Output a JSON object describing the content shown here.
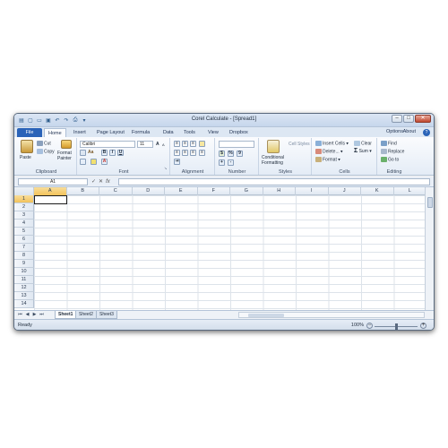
{
  "window": {
    "title": "Corel Calculate - [Spread1]"
  },
  "tabs": {
    "file": "File",
    "items": [
      "Home",
      "Insert",
      "Page Layout",
      "Formula",
      "Data",
      "Tools",
      "View",
      "Dropbox"
    ],
    "options": "Options",
    "about": "About",
    "help": "?"
  },
  "ribbon": {
    "clipboard": {
      "paste": "Paste",
      "cut": "Cut",
      "copy": "Copy",
      "format_painter_1": "Format",
      "format_painter_2": "Painter",
      "label": "Clipboard"
    },
    "font": {
      "family": "Calibri",
      "size": "11",
      "label": "Font",
      "bold": "B",
      "italic": "I",
      "underline": "U",
      "grow": "A",
      "shrink": "A"
    },
    "alignment": {
      "label": "Alignment"
    },
    "number": {
      "label": "Number",
      "pct": "%",
      "comma": "9"
    },
    "styles": {
      "cond_1": "Conditional",
      "cond_2": "Formatting",
      "cell_styles": "Cell Styles",
      "label": "Styles"
    },
    "cells": {
      "insert": "Insert Cells",
      "delete": "Delete...",
      "format": "Format",
      "label": "Cells"
    },
    "editing": {
      "clear": "Clear",
      "sum": "Sum",
      "find": "Find",
      "replace": "Replace",
      "goto": "Go to",
      "label": "Editing"
    }
  },
  "formula_bar": {
    "name_box": "A1",
    "icons": [
      "check-icon",
      "cancel-icon",
      "fx-icon"
    ],
    "fx": "fx",
    "cancel": "✕",
    "accept": "✓"
  },
  "grid": {
    "columns": [
      "A",
      "B",
      "C",
      "D",
      "E",
      "F",
      "G",
      "H",
      "I",
      "J",
      "K",
      "L"
    ],
    "rows": [
      "1",
      "2",
      "3",
      "4",
      "5",
      "6",
      "7",
      "8",
      "9",
      "10",
      "11",
      "12",
      "13",
      "14"
    ],
    "selected": "A1"
  },
  "sheets": [
    "Sheet1",
    "Sheet2",
    "Sheet3"
  ],
  "status": {
    "ready": "Ready",
    "zoom": "100%",
    "minus": "−",
    "plus": "+"
  },
  "colors": {
    "file_tab": "#2a63b8",
    "selected_header": "#f2c25a"
  }
}
